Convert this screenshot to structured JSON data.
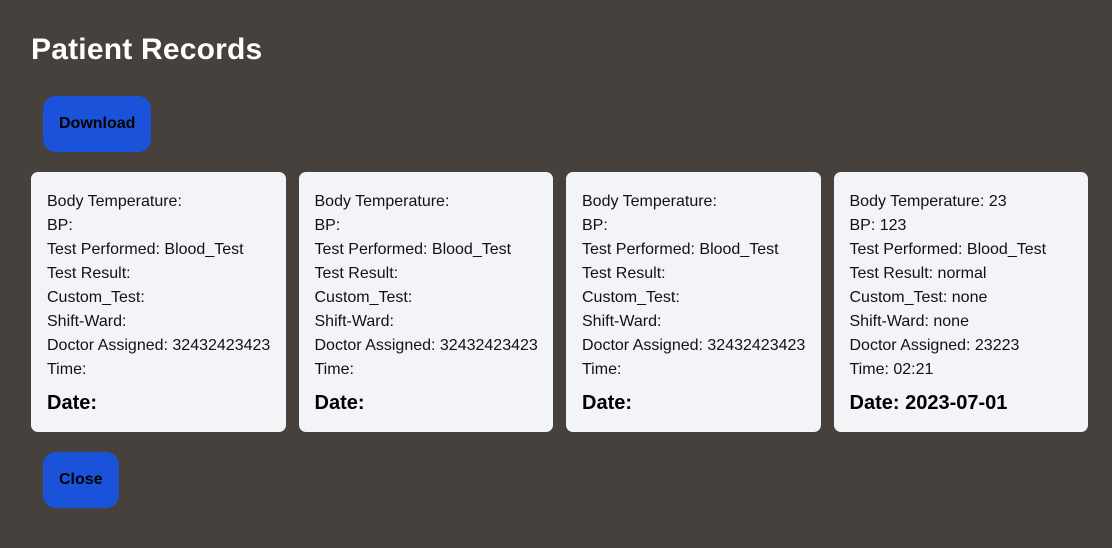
{
  "title": "Patient Records",
  "buttons": {
    "download": "Download",
    "close": "Close"
  },
  "labels": {
    "body_temperature": "Body Temperature:",
    "bp": "BP:",
    "test_performed": "Test Performed:",
    "test_result": "Test Result:",
    "custom_test": "Custom_Test:",
    "shift_ward": "Shift-Ward:",
    "doctor_assigned": "Doctor Assigned:",
    "time": "Time:",
    "date": "Date:"
  },
  "records": [
    {
      "body_temperature": "",
      "bp": "",
      "test_performed": "Blood_Test",
      "test_result": "",
      "custom_test": "",
      "shift_ward": "",
      "doctor_assigned": "32432423423",
      "time": "",
      "date": ""
    },
    {
      "body_temperature": "",
      "bp": "",
      "test_performed": "Blood_Test",
      "test_result": "",
      "custom_test": "",
      "shift_ward": "",
      "doctor_assigned": "32432423423",
      "time": "",
      "date": ""
    },
    {
      "body_temperature": "",
      "bp": "",
      "test_performed": "Blood_Test",
      "test_result": "",
      "custom_test": "",
      "shift_ward": "",
      "doctor_assigned": "32432423423",
      "time": "",
      "date": ""
    },
    {
      "body_temperature": "23",
      "bp": "123",
      "test_performed": "Blood_Test",
      "test_result": "normal",
      "custom_test": "none",
      "shift_ward": "none",
      "doctor_assigned": "23223",
      "time": "02:21",
      "date": "2023-07-01"
    }
  ],
  "colors": {
    "background": "#46413d",
    "card": "#f2f4f7",
    "button": "#1a52d9"
  }
}
